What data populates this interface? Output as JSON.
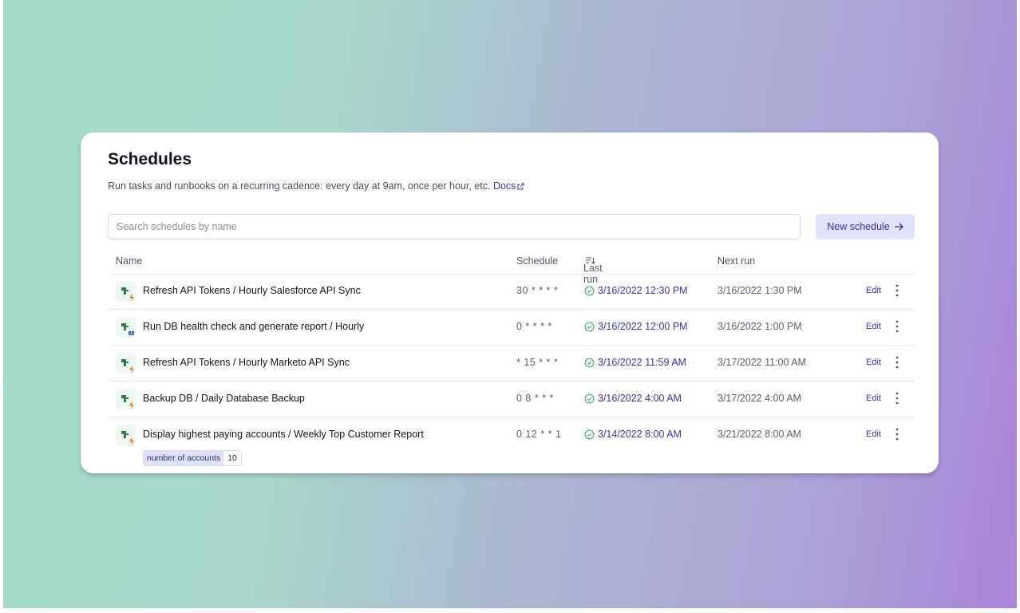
{
  "header": {
    "title": "Schedules",
    "subtitle": "Run tasks and runbooks on a recurring cadence: every day at 9am, once per hour, etc.",
    "docs_label": "Docs"
  },
  "search": {
    "placeholder": "Search schedules by name",
    "value": ""
  },
  "new_schedule_label": "New schedule",
  "table": {
    "columns": {
      "name": "Name",
      "schedule": "Schedule",
      "last_run": "Last run",
      "next_run": "Next run"
    },
    "rows": [
      {
        "name": "Refresh API Tokens / Hourly Salesforce API Sync",
        "schedule": "30 * * * *",
        "last_run": "3/16/2022 12:30 PM",
        "next_run": "3/16/2022 1:30 PM",
        "edit": "Edit",
        "icon": "task-lightning-icon"
      },
      {
        "name": "Run DB health check and generate report / Hourly",
        "schedule": "0 * * * *",
        "last_run": "3/16/2022 12:00 PM",
        "next_run": "3/16/2022 1:00 PM",
        "edit": "Edit",
        "icon": "task-grid-icon"
      },
      {
        "name": "Refresh API Tokens / Hourly Marketo API Sync",
        "schedule": "* 15 * * *",
        "last_run": "3/16/2022 11:59 AM",
        "next_run": "3/17/2022 11:00 AM",
        "edit": "Edit",
        "icon": "task-lightning-icon"
      },
      {
        "name": "Backup DB / Daily Database Backup",
        "schedule": "0 8 * * *",
        "last_run": "3/16/2022 4:00 AM",
        "next_run": "3/17/2022 4:00 AM",
        "edit": "Edit",
        "icon": "task-lightning-icon"
      },
      {
        "name": "Display highest paying accounts / Weekly Top Customer Report",
        "schedule": "0 12 * * 1",
        "last_run": "3/14/2022 8:00 AM",
        "next_run": "3/21/2022 8:00 AM",
        "edit": "Edit",
        "icon": "task-lightning-icon",
        "param": {
          "key": "number of accounts",
          "value": "10"
        }
      }
    ]
  },
  "colors": {
    "accent": "#3a34b0",
    "success": "#3bb36b",
    "button_bg": "#e1e3fa"
  }
}
